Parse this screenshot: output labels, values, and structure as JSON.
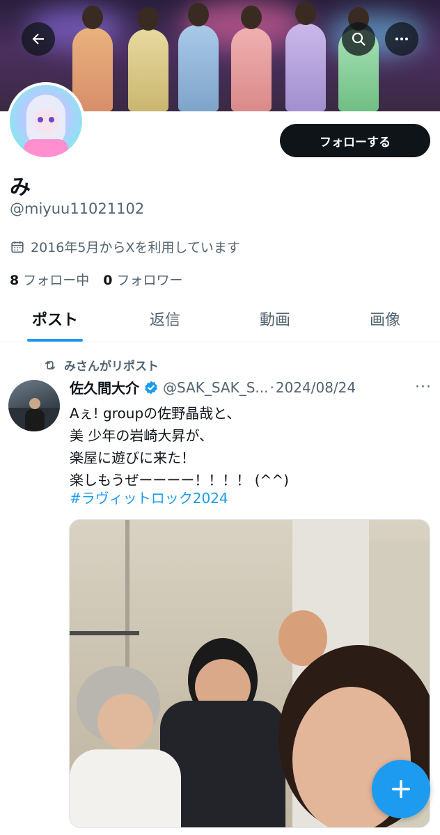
{
  "profile": {
    "display_name": "み",
    "handle": "@miyuu11021102",
    "joined": "2016年5月からXを利用しています",
    "following_count": "8",
    "following_label": "フォロー中",
    "followers_count": "0",
    "followers_label": "フォロワー",
    "follow_button": "フォローする"
  },
  "header_buttons": {
    "back": "back-arrow-icon",
    "search": "search-icon",
    "more": "more-icon"
  },
  "tabs": [
    {
      "label": "ポスト",
      "active": true
    },
    {
      "label": "返信",
      "active": false
    },
    {
      "label": "動画",
      "active": false
    },
    {
      "label": "画像",
      "active": false
    }
  ],
  "post": {
    "repost_label": "みさんがリポスト",
    "author_name": "佐久間大介",
    "author_handle": "@SAK_SAK_S...",
    "separator": "·",
    "date": "2024/08/24",
    "more": "···",
    "lines": [
      "Aぇ! groupの佐野晶哉と、",
      "美 少年の岩崎大昇が、",
      "楽屋に遊びに来た！",
      "楽しもうぜーーーー！！！！ (^^)"
    ],
    "hashtag": "#ラヴィットロック2024"
  },
  "colors": {
    "accent": "#1d9bf0",
    "text": "#0f1419",
    "secondary": "#536471",
    "button": "#0f1419"
  },
  "fab_icon": "plus-icon"
}
